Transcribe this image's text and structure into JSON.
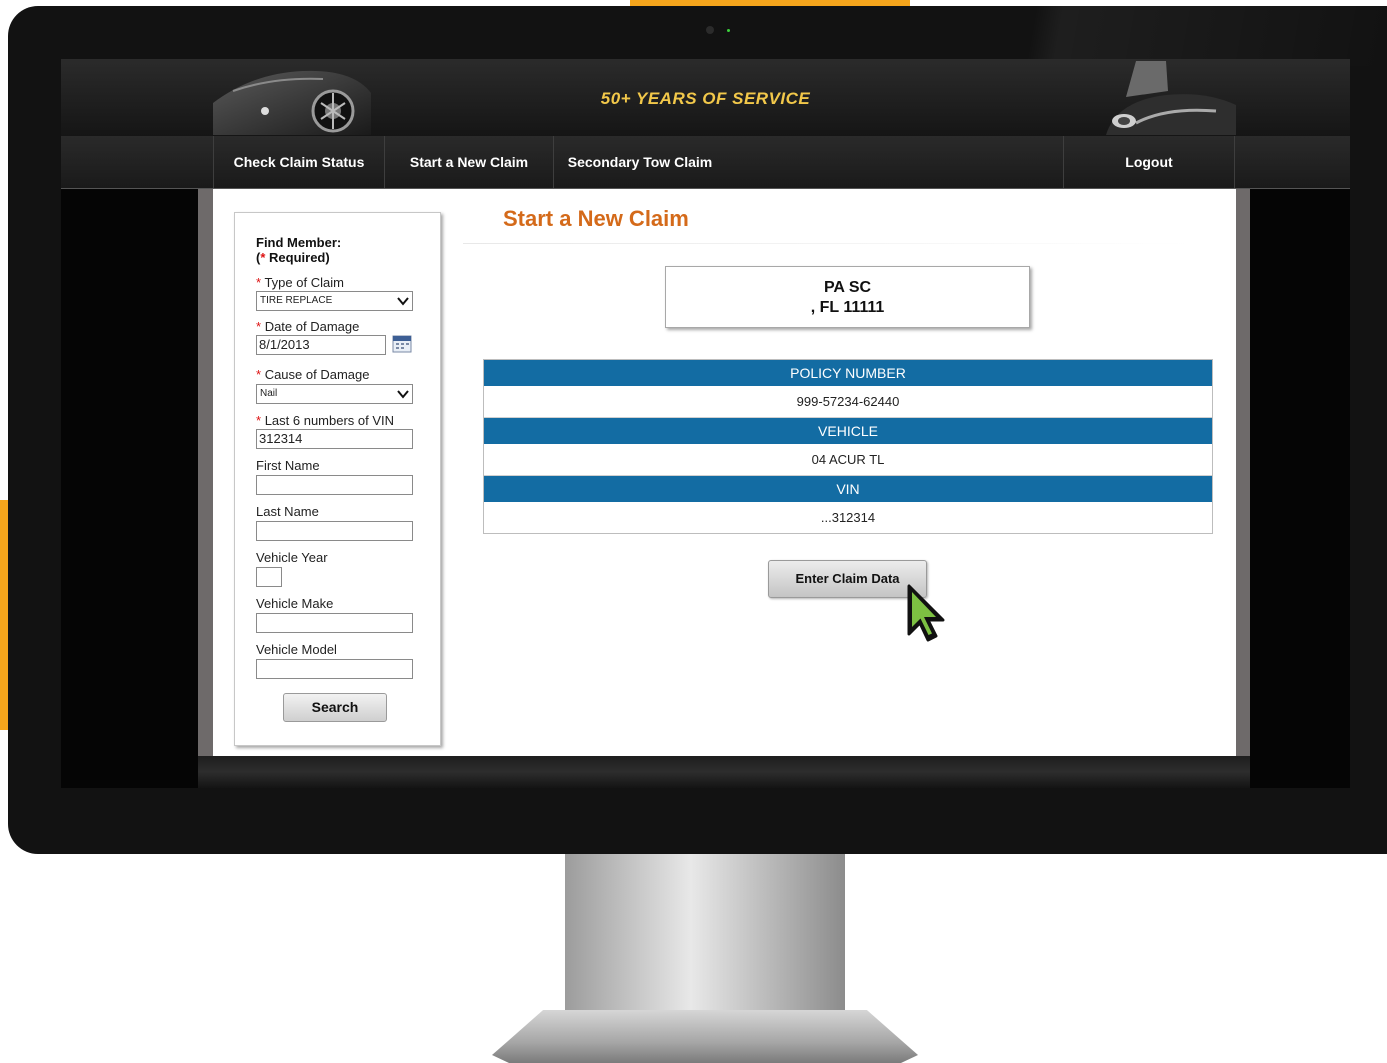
{
  "banner": {
    "tagline": "50+ YEARS OF SERVICE"
  },
  "nav": {
    "items": [
      {
        "label": "Check Claim Status"
      },
      {
        "label": "Start a New Claim"
      },
      {
        "label": "Secondary Tow Claim"
      },
      {
        "label": "Logout"
      }
    ]
  },
  "sidebar": {
    "heading_line1": "Find Member:",
    "heading_req_open": "(",
    "heading_star": "*",
    "heading_req_text": " Required)",
    "required_marker": "*",
    "fields": {
      "type_of_claim": {
        "label": "Type of Claim",
        "value": "TIRE REPLACE"
      },
      "date_of_damage": {
        "label": "Date of Damage",
        "value": "8/1/2013"
      },
      "cause_of_damage": {
        "label": "Cause of Damage",
        "value": "Nail"
      },
      "last6_vin": {
        "label": "Last 6 numbers of VIN",
        "value": "312314"
      },
      "first_name": {
        "label": "First Name",
        "value": ""
      },
      "last_name": {
        "label": "Last Name",
        "value": ""
      },
      "vehicle_year": {
        "label": "Vehicle Year",
        "value": ""
      },
      "vehicle_make": {
        "label": "Vehicle Make",
        "value": ""
      },
      "vehicle_model": {
        "label": "Vehicle Model",
        "value": ""
      }
    },
    "search_label": "Search"
  },
  "main": {
    "title": "Start a New Claim",
    "address": {
      "line1": "PA  SC",
      "line2": ", FL 11111"
    },
    "info": [
      {
        "header": "POLICY NUMBER",
        "value": "999-57234-62440"
      },
      {
        "header": "VEHICLE",
        "value": "04 ACUR  TL"
      },
      {
        "header": "VIN",
        "value": "...312314"
      }
    ],
    "enter_label": "Enter Claim Data"
  },
  "colors": {
    "accent": "#f5a51c",
    "title": "#d46a1a",
    "table_header": "#136ca3",
    "tagline": "#f2c84a"
  }
}
